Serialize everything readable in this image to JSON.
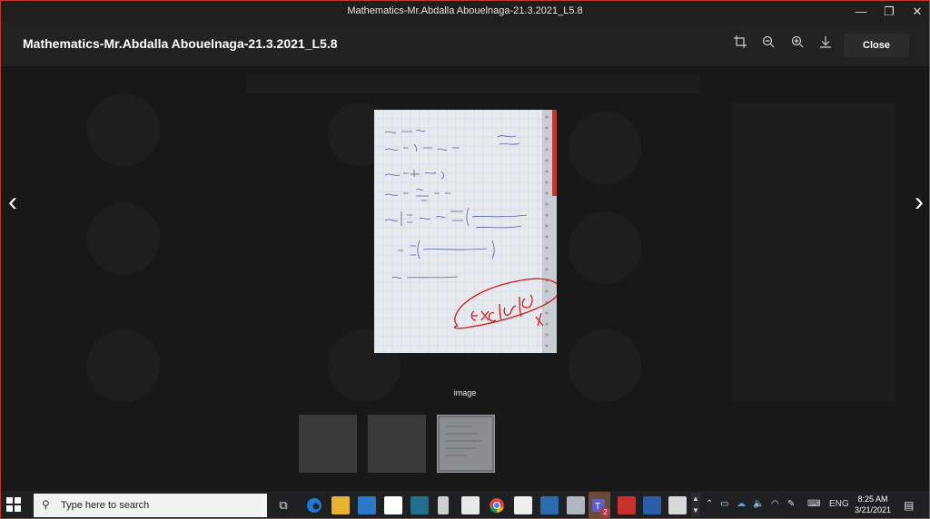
{
  "window": {
    "title": "Mathematics-Mr.Abdalla Abouelnaga-21.3.2021_L5.8",
    "minimize_glyph": "—",
    "restore_glyph": "❐",
    "close_glyph": "✕"
  },
  "appbar": {
    "title": "Mathematics-Mr.Abdalla Abouelnaga-21.3.2021_L5.8",
    "tools": [
      "crop-icon",
      "zoom-out-icon",
      "zoom-in-icon",
      "download-icon"
    ],
    "close_label": "Close"
  },
  "viewer": {
    "caption": "image",
    "prev_glyph": "‹",
    "next_glyph": "›",
    "thumbnails": [
      "thumbnail-1",
      "thumbnail-2",
      "thumbnail-3-selected"
    ]
  },
  "taskbar": {
    "search_placeholder": "Type here to search",
    "language": "ENG",
    "time": "8:25 AM",
    "date": "3/21/2021",
    "teams_badge": "2"
  }
}
